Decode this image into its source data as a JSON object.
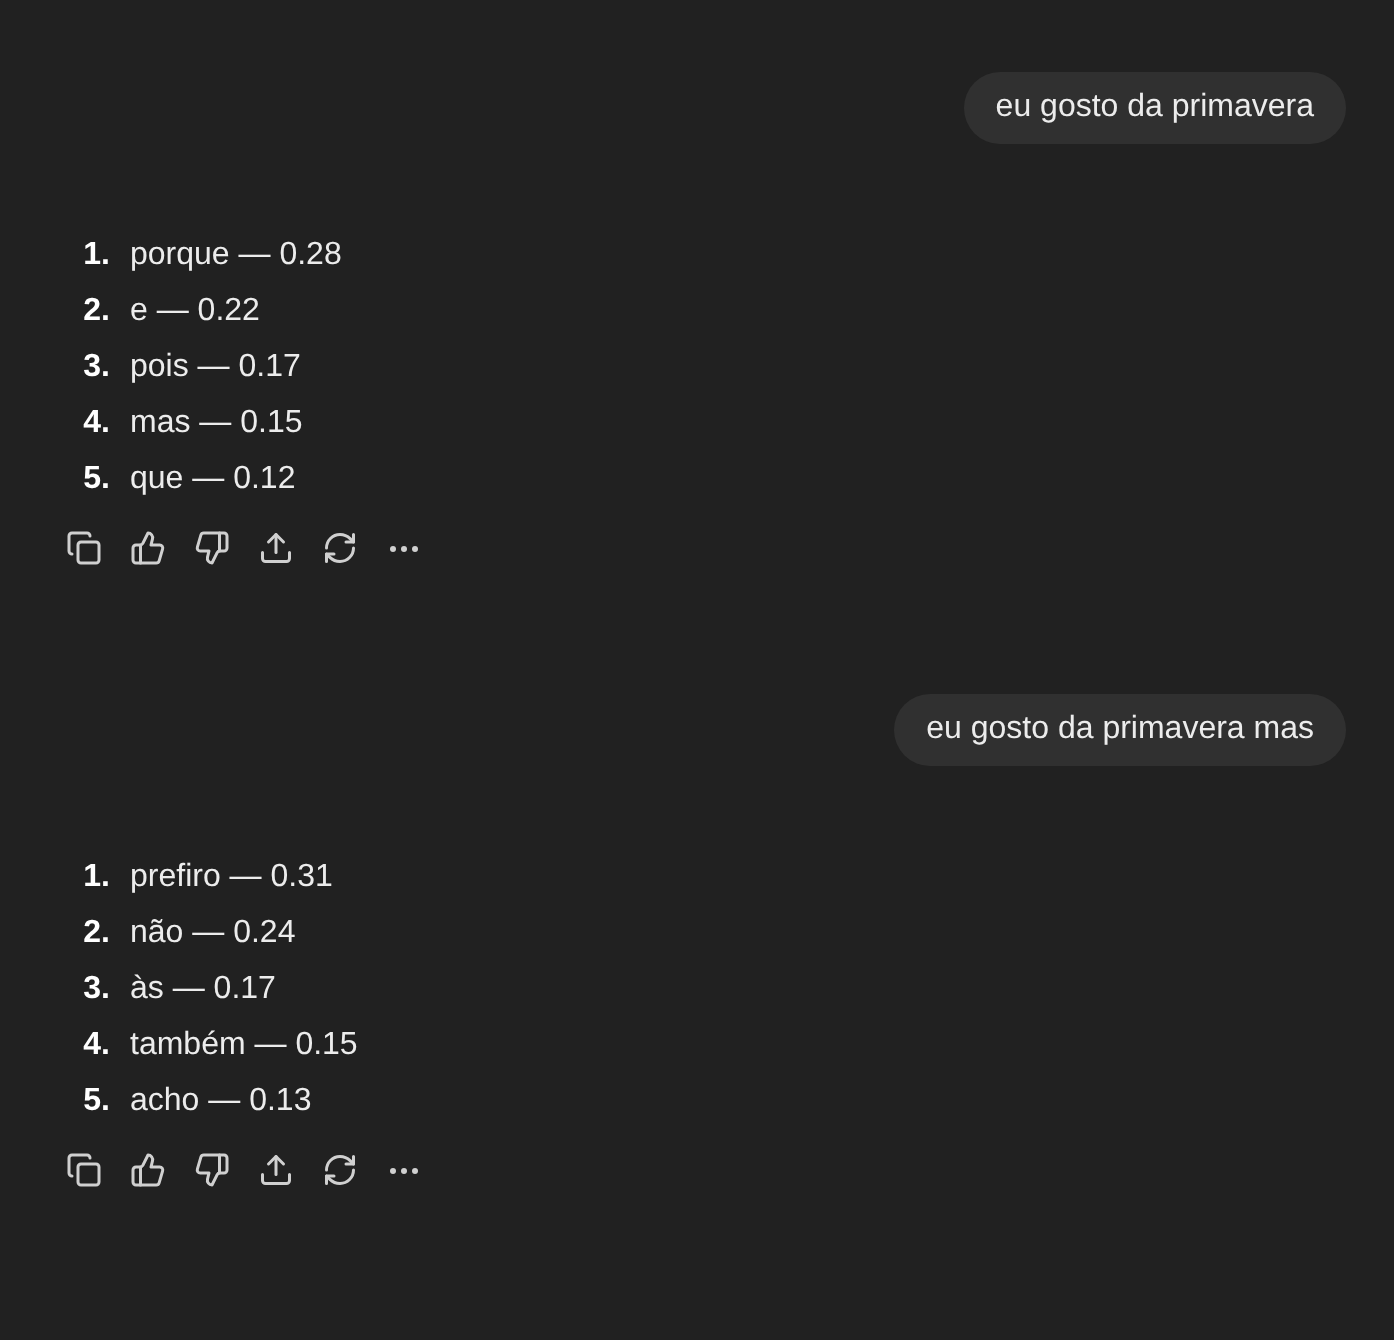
{
  "conversation": [
    {
      "kind": "user",
      "text": "eu gosto da primavera"
    },
    {
      "kind": "assistant",
      "items": [
        {
          "number": "1.",
          "text": "porque — 0.28"
        },
        {
          "number": "2.",
          "text": "e — 0.22"
        },
        {
          "number": "3.",
          "text": "pois — 0.17"
        },
        {
          "number": "4.",
          "text": "mas — 0.15"
        },
        {
          "number": "5.",
          "text": "que — 0.12"
        }
      ]
    },
    {
      "kind": "user",
      "text": "eu gosto da primavera mas"
    },
    {
      "kind": "assistant",
      "items": [
        {
          "number": "1.",
          "text": "prefiro — 0.31"
        },
        {
          "number": "2.",
          "text": "não — 0.24"
        },
        {
          "number": "3.",
          "text": "às — 0.17"
        },
        {
          "number": "4.",
          "text": "também — 0.15"
        },
        {
          "number": "5.",
          "text": "acho — 0.13"
        }
      ]
    }
  ]
}
